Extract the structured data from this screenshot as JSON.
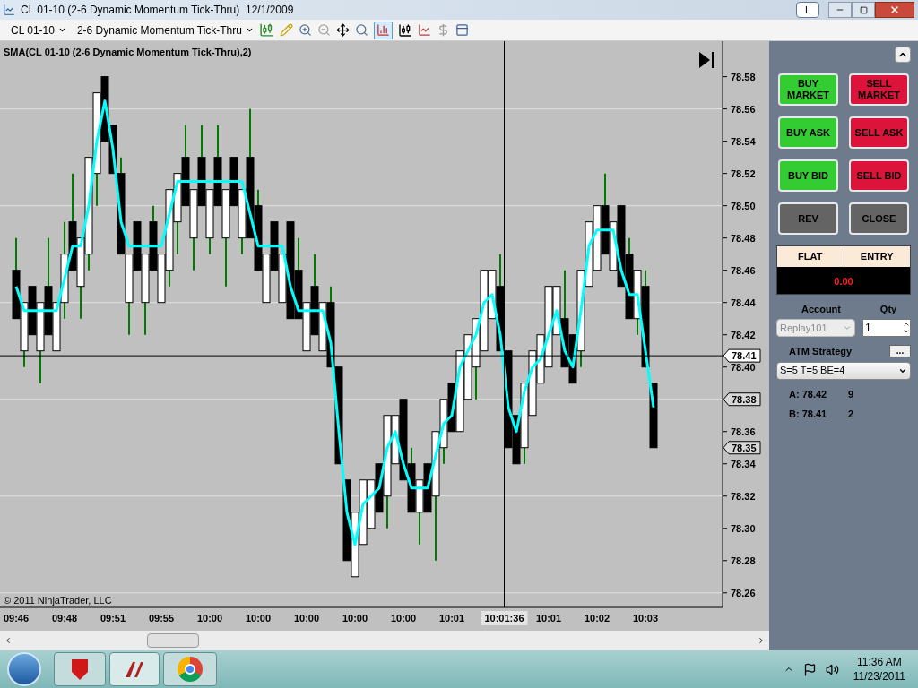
{
  "window": {
    "title": "CL 01-10 (2-6 Dynamic Momentum Tick-Thru)  12/1/2009",
    "title_button": "L"
  },
  "toolbar": {
    "instrument": "CL 01-10",
    "chart_style": "2-6 Dynamic Momentum Tick-Thru"
  },
  "chart": {
    "copyright": "© 2011 NinjaTrader, LLC",
    "price_markers": [
      {
        "label": "78.41",
        "kind": "crosshair"
      },
      {
        "label": "78.38",
        "kind": "quote"
      },
      {
        "label": "78.35",
        "kind": "quote"
      }
    ],
    "crosshair_time": "10:01:36",
    "chart_data": {
      "type": "candlestick",
      "grid": true,
      "ylim": [
        78.251,
        78.602
      ],
      "yticks": [
        {
          "value": 78.26,
          "label": "78.26"
        },
        {
          "value": 78.28,
          "label": "78.28"
        },
        {
          "value": 78.3,
          "label": "78.30"
        },
        {
          "value": 78.32,
          "label": "78.32"
        },
        {
          "value": 78.34,
          "label": "78.34"
        },
        {
          "value": 78.36,
          "label": "78.36"
        },
        {
          "value": 78.38
        },
        {
          "value": 78.4,
          "label": "78.40"
        },
        {
          "value": 78.42,
          "label": "78.42"
        },
        {
          "value": 78.44,
          "label": "78.44"
        },
        {
          "value": 78.46,
          "label": "78.46"
        },
        {
          "value": 78.48,
          "label": "78.48"
        },
        {
          "value": 78.5,
          "label": "78.50"
        },
        {
          "value": 78.52,
          "label": "78.52"
        },
        {
          "value": 78.54,
          "label": "78.54"
        },
        {
          "value": 78.56,
          "label": "78.56"
        },
        {
          "value": 78.58,
          "label": "78.58"
        }
      ],
      "ref_lines": [
        {
          "axis": "y",
          "value": 78.407
        }
      ],
      "categories": [
        "09:46",
        null,
        null,
        null,
        null,
        null,
        "09:48",
        null,
        null,
        null,
        null,
        null,
        "09:51",
        null,
        null,
        null,
        null,
        null,
        "09:55",
        null,
        null,
        null,
        null,
        null,
        "10:00",
        null,
        null,
        null,
        null,
        null,
        "10:00",
        null,
        null,
        null,
        null,
        null,
        "10:00",
        null,
        null,
        null,
        null,
        null,
        "10:00",
        null,
        null,
        null,
        null,
        null,
        "10:00",
        null,
        null,
        null,
        null,
        null,
        "10:01",
        null,
        null,
        null,
        null,
        null,
        null,
        null,
        null,
        null,
        null,
        null,
        "10:01",
        null,
        null,
        null,
        null,
        null,
        "10:02",
        null,
        null,
        null,
        null,
        null,
        "10:03",
        null
      ],
      "ohlc": [
        [
          78.46,
          78.48,
          78.43,
          78.43
        ],
        [
          78.41,
          78.44,
          78.4,
          78.44
        ],
        [
          78.45,
          78.45,
          78.42,
          78.42
        ],
        [
          78.41,
          78.44,
          78.39,
          78.44
        ],
        [
          78.45,
          78.48,
          78.42,
          78.42
        ],
        [
          78.41,
          78.44,
          78.41,
          78.44
        ],
        [
          78.44,
          78.49,
          78.43,
          78.47
        ],
        [
          78.49,
          78.52,
          78.46,
          78.46
        ],
        [
          78.45,
          78.48,
          78.43,
          78.48
        ],
        [
          78.47,
          78.53,
          78.46,
          78.53
        ],
        [
          78.52,
          78.57,
          78.5,
          78.57
        ],
        [
          78.58,
          78.58,
          78.54,
          78.54
        ],
        [
          78.55,
          78.55,
          78.52,
          78.52
        ],
        [
          78.52,
          78.53,
          78.47,
          78.47
        ],
        [
          78.44,
          78.47,
          78.42,
          78.47
        ],
        [
          78.49,
          78.49,
          78.46,
          78.46
        ],
        [
          78.44,
          78.47,
          78.42,
          78.47
        ],
        [
          78.49,
          78.5,
          78.46,
          78.46
        ],
        [
          78.44,
          78.47,
          78.44,
          78.47
        ],
        [
          78.46,
          78.51,
          78.45,
          78.51
        ],
        [
          78.49,
          78.52,
          78.47,
          78.52
        ],
        [
          78.53,
          78.55,
          78.5,
          78.5
        ],
        [
          78.48,
          78.51,
          78.46,
          78.51
        ],
        [
          78.53,
          78.55,
          78.5,
          78.5
        ],
        [
          78.48,
          78.51,
          78.47,
          78.51
        ],
        [
          78.53,
          78.55,
          78.5,
          78.5
        ],
        [
          78.48,
          78.51,
          78.45,
          78.51
        ],
        [
          78.53,
          78.53,
          78.5,
          78.5
        ],
        [
          78.48,
          78.51,
          78.47,
          78.51
        ],
        [
          78.53,
          78.56,
          78.48,
          78.48
        ],
        [
          78.5,
          78.51,
          78.46,
          78.46
        ],
        [
          78.44,
          78.47,
          78.44,
          78.47
        ],
        [
          78.49,
          78.49,
          78.46,
          78.46
        ],
        [
          78.44,
          78.47,
          78.44,
          78.47
        ],
        [
          78.49,
          78.49,
          78.43,
          78.43
        ],
        [
          78.46,
          78.48,
          78.43,
          78.43
        ],
        [
          78.41,
          78.44,
          78.41,
          78.44
        ],
        [
          78.45,
          78.47,
          78.42,
          78.42
        ],
        [
          78.41,
          78.44,
          78.41,
          78.44
        ],
        [
          78.44,
          78.45,
          78.4,
          78.4
        ],
        [
          78.4,
          78.4,
          78.34,
          78.34
        ],
        [
          78.33,
          78.33,
          78.28,
          78.28
        ],
        [
          78.27,
          78.31,
          78.27,
          78.31
        ],
        [
          78.29,
          78.33,
          78.29,
          78.33
        ],
        [
          78.3,
          78.33,
          78.3,
          78.33
        ],
        [
          78.34,
          78.34,
          78.31,
          78.31
        ],
        [
          78.32,
          78.37,
          78.3,
          78.37
        ],
        [
          78.34,
          78.37,
          78.34,
          78.37
        ],
        [
          78.38,
          78.38,
          78.33,
          78.33
        ],
        [
          78.34,
          78.35,
          78.31,
          78.31
        ],
        [
          78.31,
          78.33,
          78.29,
          78.33
        ],
        [
          78.34,
          78.34,
          78.31,
          78.31
        ],
        [
          78.32,
          78.36,
          78.28,
          78.36
        ],
        [
          78.35,
          78.38,
          78.34,
          78.38
        ],
        [
          78.39,
          78.39,
          78.36,
          78.36
        ],
        [
          78.36,
          78.41,
          78.36,
          78.41
        ],
        [
          78.38,
          78.42,
          78.38,
          78.42
        ],
        [
          78.4,
          78.43,
          78.38,
          78.43
        ],
        [
          78.41,
          78.46,
          78.41,
          78.46
        ],
        [
          78.43,
          78.46,
          78.43,
          78.46
        ],
        [
          78.45,
          78.47,
          78.41,
          78.41
        ],
        [
          78.41,
          78.41,
          78.35,
          78.35
        ],
        [
          78.37,
          78.37,
          78.34,
          78.34
        ],
        [
          78.35,
          78.39,
          78.34,
          78.39
        ],
        [
          78.37,
          78.41,
          78.37,
          78.41
        ],
        [
          78.39,
          78.42,
          78.39,
          78.42
        ],
        [
          78.4,
          78.45,
          78.4,
          78.45
        ],
        [
          78.42,
          78.45,
          78.42,
          78.45
        ],
        [
          78.43,
          78.46,
          78.4,
          78.4
        ],
        [
          78.42,
          78.42,
          78.39,
          78.39
        ],
        [
          78.41,
          78.46,
          78.4,
          78.46
        ],
        [
          78.45,
          78.49,
          78.45,
          78.49
        ],
        [
          78.46,
          78.5,
          78.46,
          78.5
        ],
        [
          78.5,
          78.52,
          78.47,
          78.47
        ],
        [
          78.46,
          78.49,
          78.46,
          78.49
        ],
        [
          78.5,
          78.5,
          78.45,
          78.45
        ],
        [
          78.47,
          78.48,
          78.43,
          78.43
        ],
        [
          78.43,
          78.46,
          78.42,
          78.46
        ],
        [
          78.45,
          78.46,
          78.4,
          78.4
        ],
        [
          78.39,
          78.39,
          78.35,
          78.35
        ]
      ],
      "series": [
        {
          "name": "SMA(CL 01-10 (2-6 Dynamic Momentum Tick-Thru),2)",
          "type": "line",
          "color": "#00ffff",
          "values": [
            78.45,
            78.435,
            78.435,
            78.435,
            78.435,
            78.435,
            78.455,
            78.475,
            78.475,
            78.5,
            78.54,
            78.565,
            78.535,
            78.49,
            78.475,
            78.475,
            78.475,
            78.475,
            78.475,
            78.495,
            78.515,
            78.515,
            78.515,
            78.515,
            78.515,
            78.515,
            78.515,
            78.515,
            78.515,
            78.495,
            78.475,
            78.475,
            78.475,
            78.475,
            78.45,
            78.435,
            78.435,
            78.435,
            78.435,
            78.415,
            78.36,
            78.31,
            78.29,
            78.315,
            78.32,
            78.325,
            78.35,
            78.36,
            78.34,
            78.325,
            78.325,
            78.325,
            78.345,
            78.365,
            78.37,
            78.4,
            78.41,
            78.42,
            78.44,
            78.445,
            78.42,
            78.375,
            78.36,
            78.385,
            78.4,
            78.405,
            78.42,
            78.435,
            78.41,
            78.4,
            78.435,
            78.475,
            78.485,
            78.485,
            78.485,
            78.46,
            78.445,
            78.445,
            78.41,
            78.375
          ]
        }
      ]
    }
  },
  "order_buttons": [
    {
      "label": "BUY MARKET",
      "kind": "buy"
    },
    {
      "label": "SELL MARKET",
      "kind": "sell"
    },
    {
      "label": "BUY ASK",
      "kind": "buy"
    },
    {
      "label": "SELL ASK",
      "kind": "sell"
    },
    {
      "label": "BUY BID",
      "kind": "buy"
    },
    {
      "label": "SELL BID",
      "kind": "sell"
    },
    {
      "label": "REV",
      "kind": "neutral"
    },
    {
      "label": "CLOSE",
      "kind": "neutral"
    }
  ],
  "position": {
    "headers": [
      "FLAT",
      "ENTRY"
    ],
    "pnl": "0.00"
  },
  "account": {
    "label": "Account",
    "value": "Replay101",
    "disabled": true
  },
  "qty": {
    "label": "Qty",
    "value": "1"
  },
  "atm": {
    "label": "ATM Strategy",
    "button": "...",
    "value": "S=5 T=5 BE=4"
  },
  "quotes": [
    {
      "label": "A: 78.42",
      "size": "9"
    },
    {
      "label": "B: 78.41",
      "size": "2"
    }
  ],
  "taskbar": {
    "time": "11:36 AM",
    "date": "11/23/2011"
  }
}
